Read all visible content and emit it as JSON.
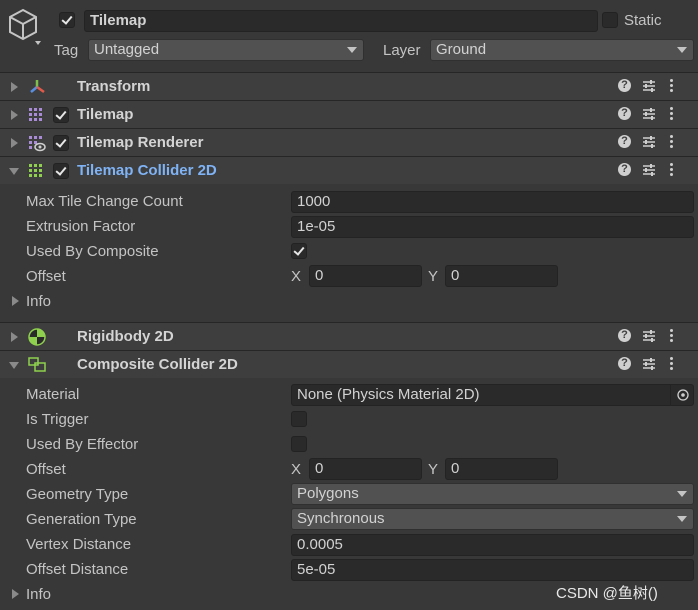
{
  "header": {
    "name": "Tilemap",
    "active": true,
    "static_label": "Static",
    "static_checked": false,
    "tag_label": "Tag",
    "tag_value": "Untagged",
    "layer_label": "Layer",
    "layer_value": "Ground"
  },
  "components": {
    "transform": {
      "title": "Transform"
    },
    "tilemap": {
      "title": "Tilemap",
      "enabled": true
    },
    "tilemap_renderer": {
      "title": "Tilemap Renderer",
      "enabled": true
    },
    "tilemap_collider": {
      "title": "Tilemap Collider 2D",
      "enabled": true,
      "max_tile_change_count_label": "Max Tile Change Count",
      "max_tile_change_count": "1000",
      "extrusion_factor_label": "Extrusion Factor",
      "extrusion_factor": "1e-05",
      "used_by_composite_label": "Used By Composite",
      "used_by_composite": true,
      "offset_label": "Offset",
      "offset_x_label": "X",
      "offset_x": "0",
      "offset_y_label": "Y",
      "offset_y": "0",
      "info_label": "Info"
    },
    "rigidbody": {
      "title": "Rigidbody 2D"
    },
    "composite_collider": {
      "title": "Composite Collider 2D",
      "material_label": "Material",
      "material": "None (Physics Material 2D)",
      "is_trigger_label": "Is Trigger",
      "is_trigger": false,
      "used_by_effector_label": "Used By Effector",
      "used_by_effector": false,
      "offset_label": "Offset",
      "offset_x_label": "X",
      "offset_x": "0",
      "offset_y_label": "Y",
      "offset_y": "0",
      "geometry_type_label": "Geometry Type",
      "geometry_type": "Polygons",
      "generation_type_label": "Generation Type",
      "generation_type": "Synchronous",
      "vertex_distance_label": "Vertex Distance",
      "vertex_distance": "0.0005",
      "offset_distance_label": "Offset Distance",
      "offset_distance": "5e-05",
      "info_label": "Info"
    }
  },
  "icons": {
    "gameobject": "cube-icon",
    "transform": "transform-axes-icon",
    "tilemap": "grid-icon",
    "help": "help-icon",
    "presets": "presets-icon",
    "menu": "kebab-menu-icon"
  },
  "colors": {
    "background": "#383838",
    "header_bg": "#3e3e3e",
    "field_bg": "#2a2a2a",
    "highlight_title": "#7fb3f5",
    "grid_icon": "#a98bd8",
    "grid_icon_active": "#8fd14f",
    "rigidbody_icon": "#8fd14f"
  },
  "watermark": "CSDN @鱼树(﻿﻿﻿)"
}
